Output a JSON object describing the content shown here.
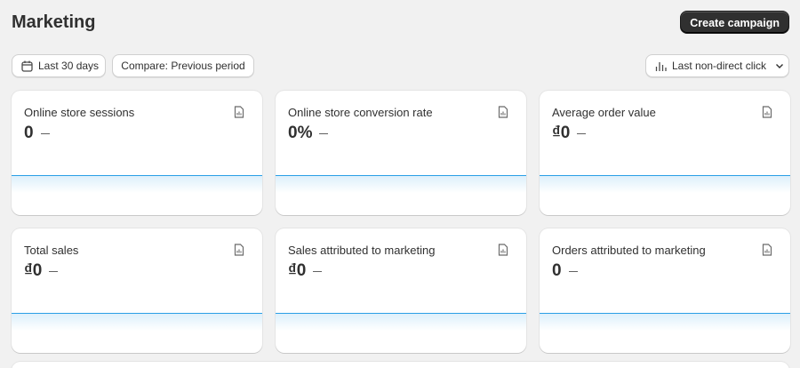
{
  "header": {
    "title": "Marketing",
    "create_campaign": "Create campaign"
  },
  "filters": {
    "date_range": "Last 30 days",
    "compare": "Compare: Previous period",
    "attribution": "Last non-direct click"
  },
  "metrics": [
    {
      "title": "Online store sessions",
      "value": "0"
    },
    {
      "title": "Online store conversion rate",
      "value": "0%"
    },
    {
      "title": "Average order value",
      "value": "₫0"
    },
    {
      "title": "Total sales",
      "value": "₫0"
    },
    {
      "title": "Sales attributed to marketing",
      "value": "₫0"
    },
    {
      "title": "Orders attributed to marketing",
      "value": "0"
    }
  ],
  "colors": {
    "primary_button": "#303030",
    "background": "#f1f1f1",
    "sparkline": "#2b9fe6"
  },
  "icons": {
    "date": "calendar-icon",
    "attribution": "bar-chart-icon",
    "dropdown": "chevron-down-icon",
    "report": "report-icon"
  }
}
